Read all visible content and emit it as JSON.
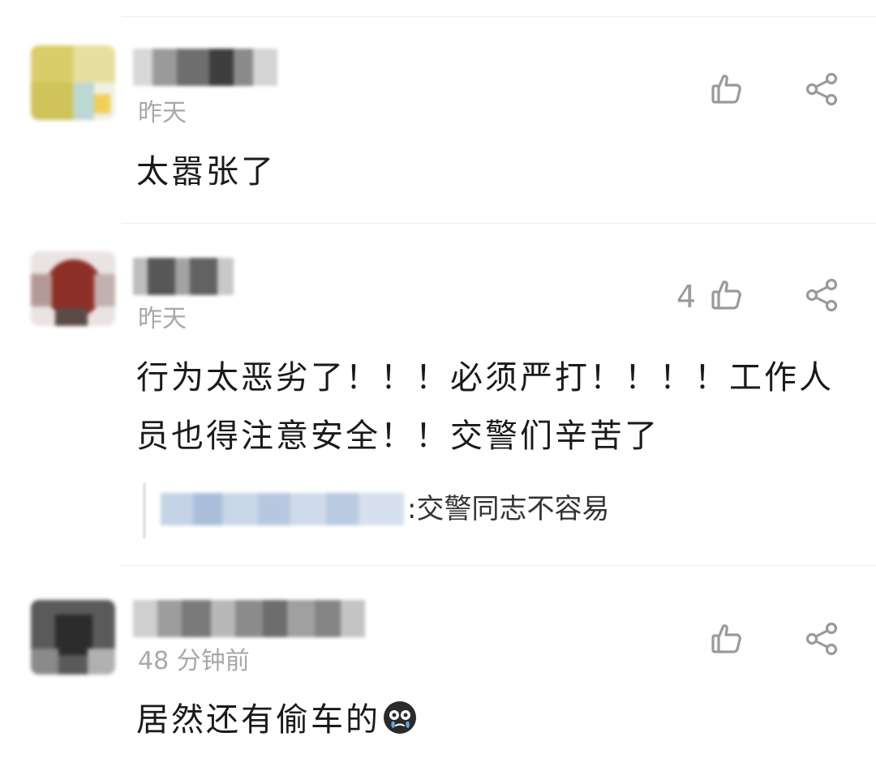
{
  "colors": {
    "divider": "#ededed",
    "muted_text": "#a8a8a8",
    "icon": "#9a9a9a",
    "body_text": "#1a1a1a"
  },
  "comments": [
    {
      "time": "昨天",
      "text": "太嚣张了",
      "like_count": "",
      "icons": [
        "thumbs-up-icon",
        "share-icon"
      ]
    },
    {
      "time": "昨天",
      "text": "行为太恶劣了！！！必须严打！！！！工作人员也得注意安全！！交警们辛苦了",
      "like_count": "4",
      "icons": [
        "thumbs-up-icon",
        "share-icon"
      ],
      "reply": {
        "text": ":交警同志不容易"
      }
    },
    {
      "time": "48 分钟前",
      "text": "居然还有偷车的",
      "like_count": "",
      "icons": [
        "thumbs-up-icon",
        "share-icon",
        "crying-face-emoji"
      ]
    }
  ]
}
